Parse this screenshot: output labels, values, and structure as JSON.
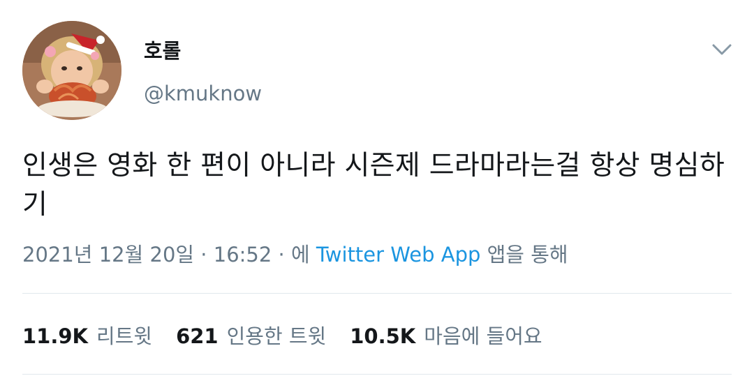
{
  "tweet": {
    "display_name": "호롤",
    "handle": "@kmuknow",
    "text": "인생은 영화 한 편이 아니라 시즌제 드라마라는걸 항상 명심하기",
    "timestamp": "2021년 12월 20일 · 16:52 · 에",
    "source": "Twitter Web App",
    "source_suffix": "앱을 통해",
    "stats": {
      "retweets": {
        "value": "11.9K",
        "label": "리트윗"
      },
      "quotes": {
        "value": "621",
        "label": "인용한 트윗"
      },
      "likes": {
        "value": "10.5K",
        "label": "마음에 들어요"
      }
    }
  },
  "colors": {
    "text": "#14171a",
    "secondary": "#657786",
    "link": "#1b95e0",
    "divider": "#e1e8ed"
  },
  "icons": {
    "more_menu": "chevron-down-icon"
  }
}
